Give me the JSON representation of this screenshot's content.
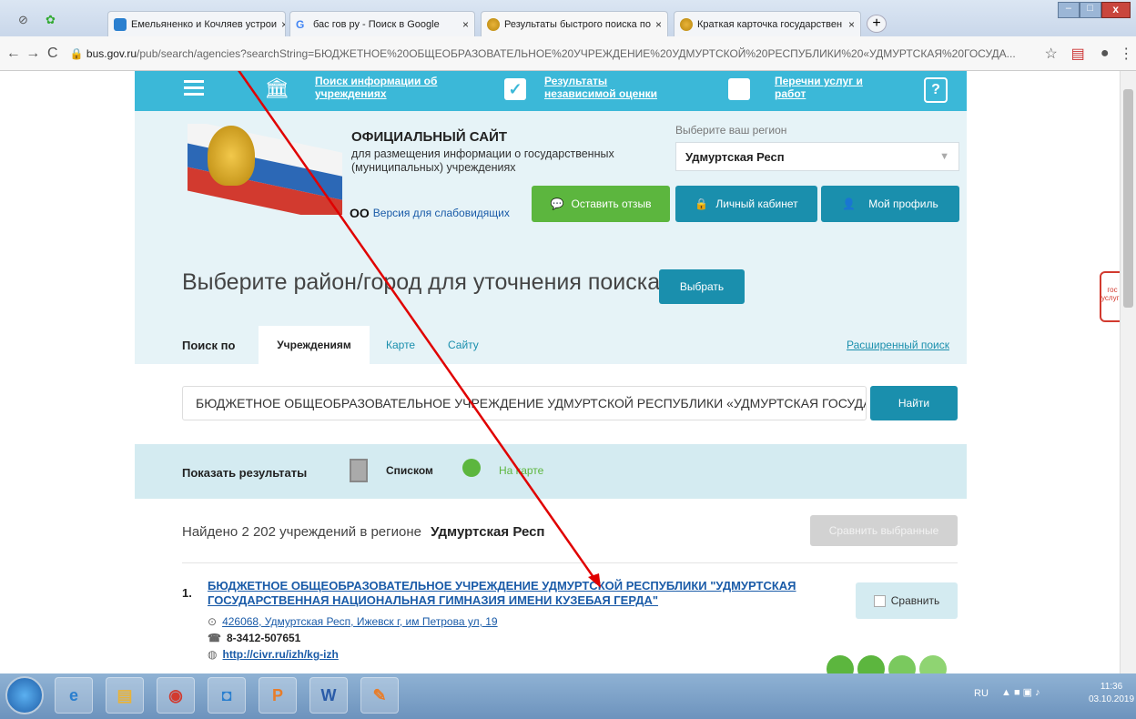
{
  "browser": {
    "tabs": [
      {
        "label": "Емельяненко и Кочляев устрои"
      },
      {
        "label": "бас гов ру - Поиск в Google"
      },
      {
        "label": "Результаты быстрого поиска по"
      },
      {
        "label": "Краткая карточка государствен"
      }
    ],
    "url_domain": "bus.gov.ru",
    "url_path": "/pub/search/agencies?searchString=БЮДЖЕТНОЕ%20ОБЩЕОБРАЗОВАТЕЛЬНОЕ%20УЧРЕЖДЕНИЕ%20УДМУРТСКОЙ%20РЕСПУБЛИКИ%20«УДМУРТСКАЯ%20ГОСУДА..."
  },
  "topnav": {
    "item1": "Поиск информации об учреждениях",
    "item2": "Результаты независимой оценки",
    "item3": "Перечни услуг и работ"
  },
  "header": {
    "site_title": "ОФИЦИАЛЬНЫЙ САЙТ",
    "site_desc": "для размещения информации о государственных (муниципальных) учреждениях",
    "low_vision": "Версия для слабовидящих",
    "region_label": "Выберите ваш регион",
    "region_value": "Удмуртская Респ",
    "feedback_btn": "Оставить отзыв",
    "cabinet_btn": "Личный кабинет",
    "profile_btn": "Мой профиль"
  },
  "city": {
    "title": "Выберите район/город для уточнения поиска",
    "button": "Выбрать"
  },
  "search": {
    "label": "Поиск по",
    "tabs": [
      "Учреждениям",
      "Карте",
      "Сайту"
    ],
    "advanced": "Расширенный поиск",
    "value": "БЮДЖЕТНОЕ ОБЩЕОБРАЗОВАТЕЛЬНОЕ УЧРЕЖДЕНИЕ УДМУРТСКОЙ РЕСПУБЛИКИ «УДМУРТСКАЯ ГОСУДА",
    "button": "Найти"
  },
  "show": {
    "label": "Показать результаты",
    "list": "Списком",
    "map": "На карте"
  },
  "results": {
    "found_prefix": "Найдено 2 202 учреждений  в регионе",
    "found_region": "Удмуртская Респ",
    "compare_selected": "Сравнить выбранные",
    "items": [
      {
        "num": "1.",
        "name": "БЮДЖЕТНОЕ ОБЩЕОБРАЗОВАТЕЛЬНОЕ УЧРЕЖДЕНИЕ УДМУРТСКОЙ РЕСПУБЛИКИ \"УДМУРТСКАЯ ГОСУДАРСТВЕННАЯ НАЦИОНАЛЬНАЯ ГИМНАЗИЯ ИМЕНИ КУЗЕБАЯ ГЕРДА\"",
        "address": "426068, Удмуртская Респ, Ижевск г, им Петрова ул, 19",
        "phone": "8-3412-507651",
        "site": "http://civr.ru/izh/kg-izh",
        "compare": "Сравнить"
      }
    ]
  },
  "side_widget": "гос услуги",
  "taskbar": {
    "lang": "RU",
    "time": "11:36",
    "date": "03.10.2019"
  },
  "colors": {
    "nav": "#3bb8d8",
    "header_bg": "#e6f3f7",
    "teal": "#1a8fad",
    "green": "#5cb63e",
    "arrow": "#e00000"
  }
}
